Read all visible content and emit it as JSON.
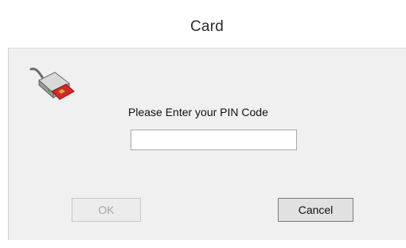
{
  "window": {
    "title": "Card"
  },
  "dialog": {
    "prompt": "Please Enter your PIN Code",
    "pin_value": "",
    "ok_label": "OK",
    "cancel_label": "Cancel",
    "icon": "card-reader-icon"
  },
  "colors": {
    "client_background": "#f0f0f0",
    "card_red": "#d6262b",
    "chip_gold": "#e2b33a",
    "reader_gray": "#9a9a9a",
    "disabled_text": "#a4a4a4"
  }
}
